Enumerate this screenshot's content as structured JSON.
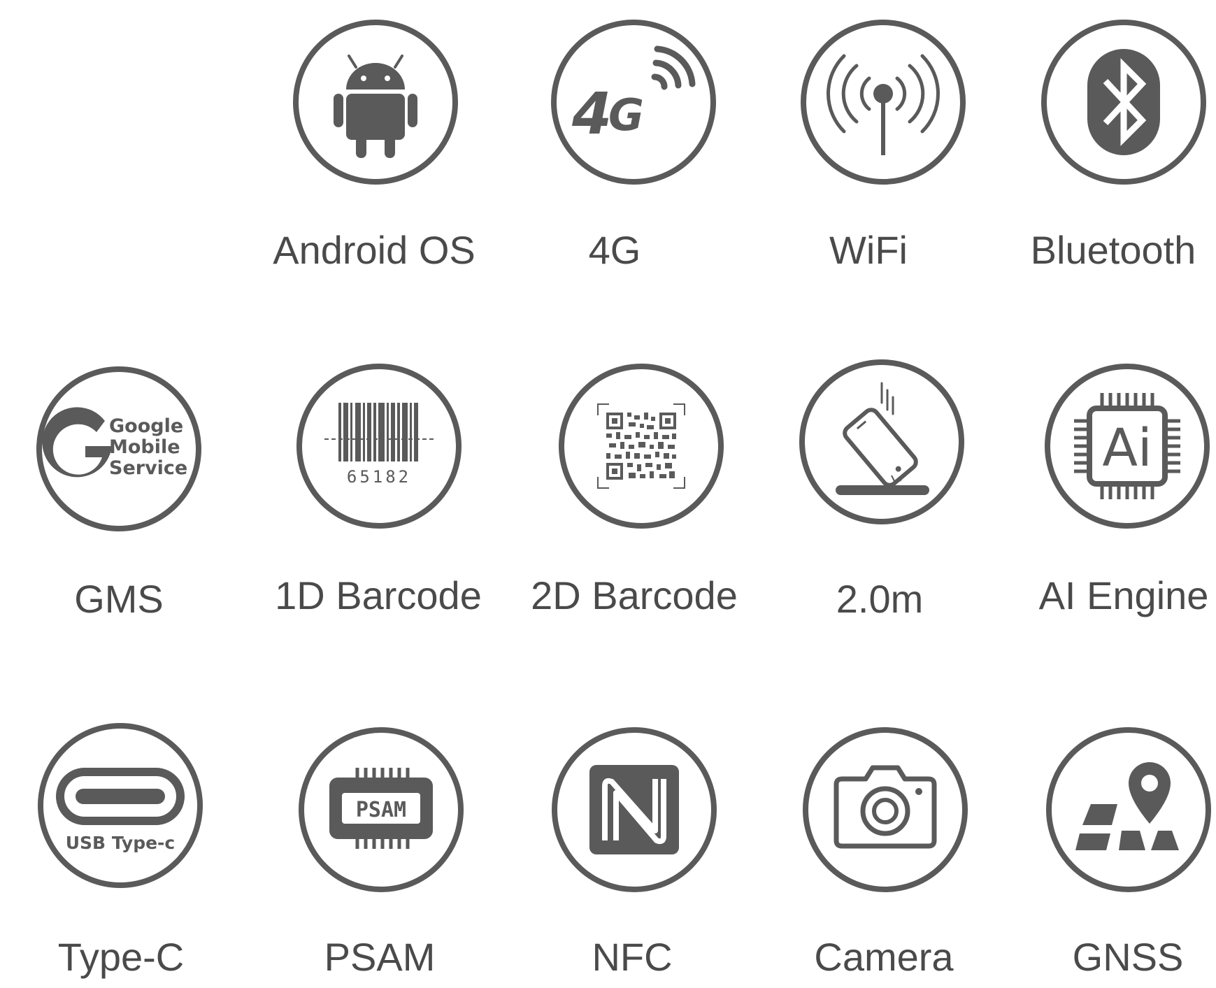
{
  "theme": {
    "icon_color": "#5a5a5a",
    "label_color": "#4a4a4a",
    "background": "#ffffff"
  },
  "features": [
    {
      "id": "android",
      "label": "Android OS",
      "icon": "android-robot-icon"
    },
    {
      "id": "4g",
      "label": "4G",
      "icon": "4g-signal-icon"
    },
    {
      "id": "wifi",
      "label": "WiFi",
      "icon": "wifi-antenna-icon"
    },
    {
      "id": "bluetooth",
      "label": "Bluetooth",
      "icon": "bluetooth-icon"
    },
    {
      "id": "gms",
      "label": "GMS",
      "icon": "google-mobile-service-icon",
      "icon_text": [
        "Google",
        "Mobile",
        "Service"
      ]
    },
    {
      "id": "barcode-1d",
      "label": "1D Barcode",
      "icon": "barcode-1d-icon",
      "icon_text": "65182"
    },
    {
      "id": "barcode-2d",
      "label": "2D Barcode",
      "icon": "qr-code-icon"
    },
    {
      "id": "drop",
      "label": "2.0m",
      "icon": "drop-resistant-phone-icon"
    },
    {
      "id": "ai",
      "label": "AI Engine",
      "icon": "ai-chip-icon",
      "icon_text": "Ai"
    },
    {
      "id": "typec",
      "label": "Type-C",
      "icon": "usb-type-c-icon",
      "icon_text": "USB Type-c"
    },
    {
      "id": "psam",
      "label": "PSAM",
      "icon": "psam-chip-icon",
      "icon_text": "PSAM"
    },
    {
      "id": "nfc",
      "label": "NFC",
      "icon": "nfc-icon"
    },
    {
      "id": "camera",
      "label": "Camera",
      "icon": "camera-icon"
    },
    {
      "id": "gnss",
      "label": "GNSS",
      "icon": "map-pin-icon"
    }
  ]
}
